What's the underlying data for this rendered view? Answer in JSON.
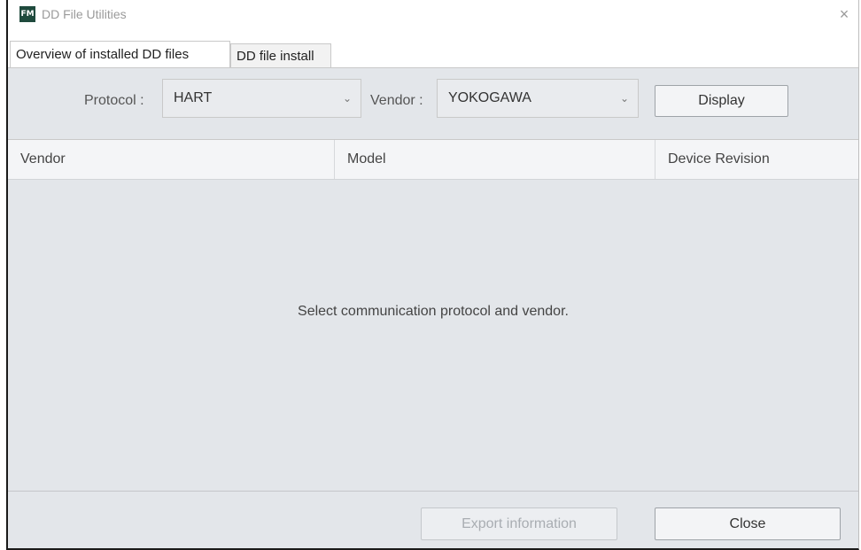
{
  "window": {
    "title": "DD File Utilities",
    "icon_text": "FM",
    "close_glyph": "×"
  },
  "tabs": [
    {
      "label": "Overview of installed DD files",
      "active": true
    },
    {
      "label": "DD file install",
      "active": false
    }
  ],
  "filters": {
    "protocol_label": "Protocol :",
    "protocol_value": "HART",
    "vendor_label": "Vendor :",
    "vendor_value": "YOKOGAWA",
    "display_button": "Display",
    "chevron": "⌄"
  },
  "table": {
    "columns": [
      "Vendor",
      "Model",
      "Device Revision"
    ],
    "empty_message": "Select communication protocol and vendor."
  },
  "footer": {
    "export_button": "Export information",
    "close_button": "Close"
  },
  "colors": {
    "panel_bg": "#e3e6ea",
    "header_bg": "#f4f5f7",
    "icon_bg": "#1f4a3d"
  }
}
